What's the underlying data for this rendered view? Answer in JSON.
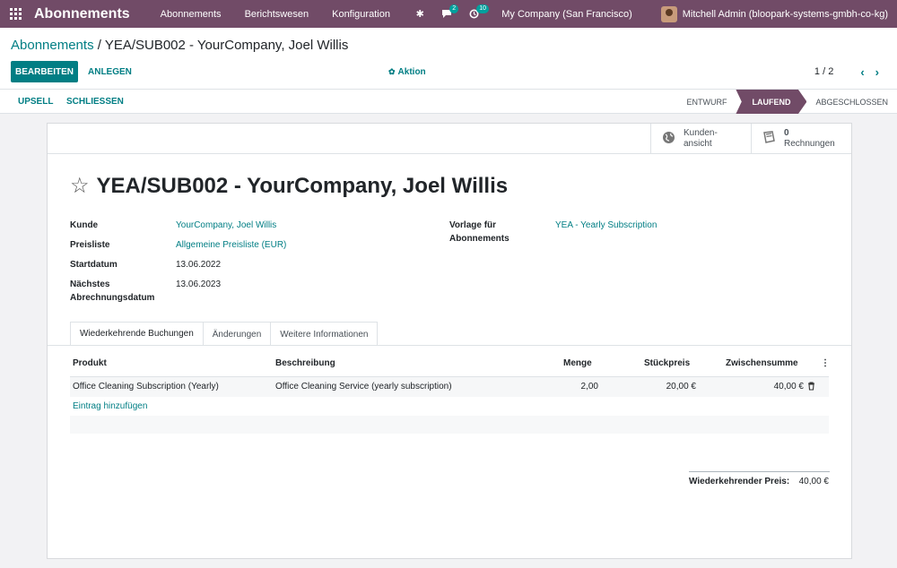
{
  "navbar": {
    "brand": "Abonnements",
    "menu": [
      "Abonnements",
      "Berichtswesen",
      "Konfiguration"
    ],
    "chat_badge": "2",
    "activity_badge": "10",
    "company": "My Company (San Francisco)",
    "user": "Mitchell Admin (bloopark-systems-gmbh-co-kg)"
  },
  "breadcrumb": {
    "parent": "Abonnements",
    "separator": " / ",
    "current": "YEA/SUB002 - YourCompany, Joel Willis"
  },
  "toolbar": {
    "edit_label": "BEARBEITEN",
    "create_label": "ANLEGEN",
    "action_label": "Aktion",
    "pager_value": "1 / 2"
  },
  "header": {
    "upsell_label": "UPSELL",
    "close_label": "SCHLIESSEN",
    "stages": [
      "ENTWURF",
      "LAUFEND",
      "ABGESCHLOSSEN"
    ],
    "active_stage": "LAUFEND"
  },
  "smart_buttons": {
    "portal": {
      "line1": "Kunden-",
      "line2": "ansicht",
      "icon": "globe-icon"
    },
    "invoices": {
      "count": "0",
      "label": "Rechnungen",
      "icon": "book-icon"
    }
  },
  "record": {
    "title": "YEA/SUB002 - YourCompany, Joel Willis",
    "fields_left": [
      {
        "label": "Kunde",
        "value": "YourCompany, Joel Willis",
        "link": true
      },
      {
        "label": "Preisliste",
        "value": "Allgemeine Preisliste (EUR)",
        "link": true
      },
      {
        "label": "Startdatum",
        "value": "13.06.2022",
        "link": false
      },
      {
        "label_line1": "Nächstes",
        "label_line2": "Abrechnungsdatum",
        "value": "13.06.2023",
        "link": false
      }
    ],
    "fields_right": [
      {
        "label_line1": "Vorlage für",
        "label_line2": "Abonnements",
        "value": "YEA - Yearly Subscription",
        "link": true
      }
    ]
  },
  "tabs": [
    "Wiederkehrende Buchungen",
    "Änderungen",
    "Weitere Informationen"
  ],
  "table": {
    "columns": [
      "Produkt",
      "Beschreibung",
      "Menge",
      "Stückpreis",
      "Zwischensumme"
    ],
    "rows": [
      {
        "product": "Office Cleaning Subscription (Yearly)",
        "description": "Office Cleaning Service (yearly subscription)",
        "quantity": "2,00",
        "unit_price": "20,00 €",
        "subtotal": "40,00 €"
      }
    ],
    "add_line_label": "Eintrag hinzufügen"
  },
  "totals": {
    "label": "Wiederkehrender Preis:",
    "value": "40,00 €"
  },
  "colors": {
    "brand": "#714b67",
    "accent": "#017e84"
  }
}
